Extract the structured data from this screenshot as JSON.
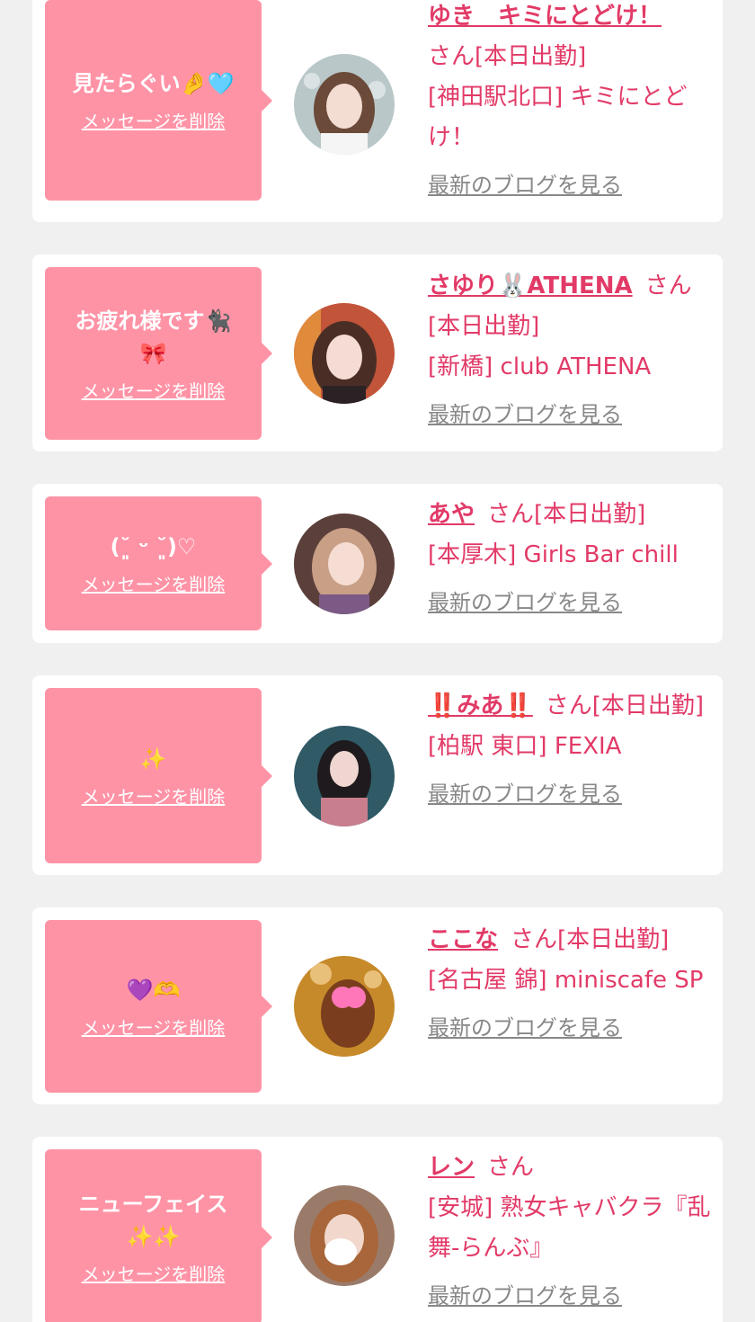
{
  "colors": {
    "accent": "#e23a67",
    "bubble": "#ff93a6",
    "background": "#f0f0f0",
    "link_gray": "#888888"
  },
  "labels": {
    "delete": "メッセージを削除",
    "blog": "最新のブログを見る",
    "san": "さん"
  },
  "cards": [
    {
      "message": "見たらぐい🤌🩵",
      "name": "ゆき　キミにとどけ！",
      "suffix": "[本日出勤]",
      "shop": "[神田駅北口] キミにとどけ！",
      "avatar_icon": "girl-portrait-icon"
    },
    {
      "message": "お疲れ様です🐈‍⬛\n🎀",
      "name": "さゆり🐰ATHENA",
      "suffix": "[本日出勤]",
      "shop": "[新橋] club ATHENA",
      "avatar_icon": "girl-portrait-icon"
    },
    {
      "message": "(˘͈ ᵕ ˘͈)♡",
      "name": "あや",
      "suffix": "[本日出勤]",
      "shop": "[本厚木] Girls Bar chill",
      "avatar_icon": "girl-portrait-icon"
    },
    {
      "message": "✨",
      "name": "‼️みあ‼️",
      "suffix": "[本日出勤]",
      "shop": "[柏駅 東口] FEXIA",
      "avatar_icon": "girl-portrait-icon"
    },
    {
      "message": "💜🫶",
      "name": "ここな",
      "suffix": "[本日出勤]",
      "shop": "[名古屋 錦] miniscafe SP",
      "avatar_icon": "girl-portrait-icon"
    },
    {
      "message": "ニューフェイス\n✨✨",
      "name": "レン",
      "suffix": "",
      "shop": "[安城] 熟女キャバクラ『乱舞-らんぶ』",
      "avatar_icon": "girl-portrait-icon"
    }
  ]
}
